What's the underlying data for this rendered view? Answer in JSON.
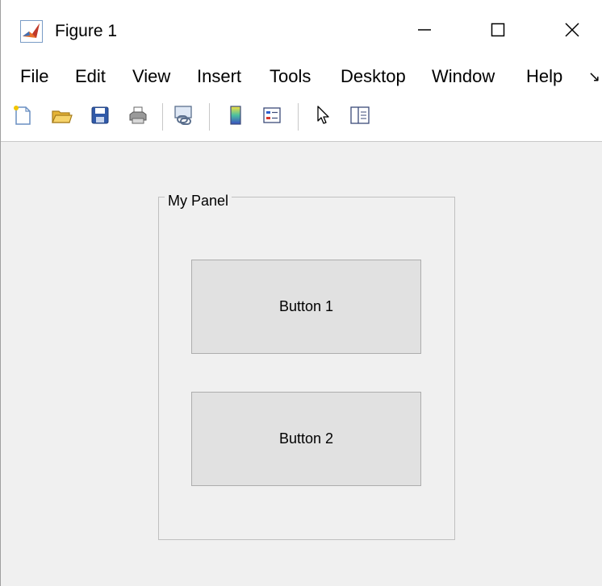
{
  "window": {
    "title": "Figure 1"
  },
  "menubar": {
    "items": [
      "File",
      "Edit",
      "View",
      "Insert",
      "Tools",
      "Desktop",
      "Window",
      "Help"
    ],
    "overflow_glyph": "↘"
  },
  "toolbar": {
    "buttons": [
      {
        "icon": "new-figure-icon"
      },
      {
        "icon": "open-file-icon"
      },
      {
        "icon": "save-icon"
      },
      {
        "icon": "print-icon"
      },
      {
        "icon": "link-plot-icon"
      },
      {
        "icon": "colorbar-icon"
      },
      {
        "icon": "legend-icon"
      },
      {
        "icon": "pointer-icon"
      },
      {
        "icon": "property-inspector-icon"
      }
    ]
  },
  "figure": {
    "panel": {
      "title": "My Panel"
    },
    "buttons": [
      {
        "label": "Button 1"
      },
      {
        "label": "Button 2"
      }
    ]
  },
  "colors": {
    "background": "#f0f0f0",
    "chrome": "#ffffff",
    "button_face": "#e1e1e1",
    "button_border": "#adadad",
    "panel_border": "#c0c0c0"
  }
}
